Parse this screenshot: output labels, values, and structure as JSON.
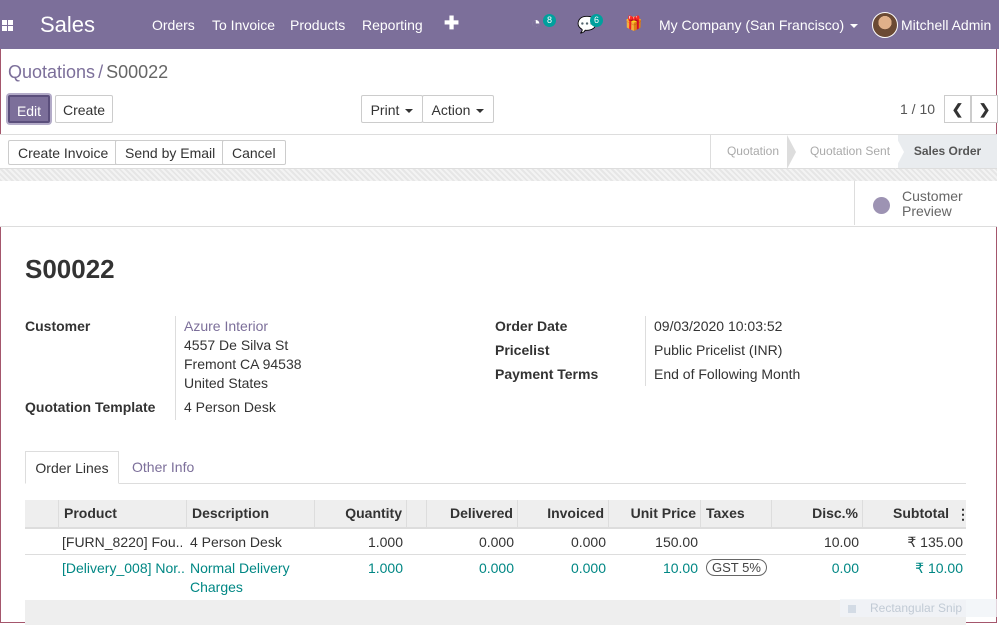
{
  "nav": {
    "app_name": "Sales",
    "menu": [
      "Orders",
      "To Invoice",
      "Products",
      "Reporting"
    ],
    "plus": "✚",
    "activity_count": "8",
    "messages_count": "6",
    "company": "My Company (San Francisco)",
    "user": "Mitchell Admin",
    "accent": "#7c6f9a"
  },
  "breadcrumb": {
    "parent": "Quotations",
    "separator": "/",
    "current": "S00022"
  },
  "toolbar": {
    "edit": "Edit",
    "create": "Create",
    "print": "Print",
    "action": "Action"
  },
  "pager": {
    "value": "1 / 10",
    "prev": "❮",
    "next": "❯"
  },
  "statusbar": {
    "buttons": [
      "Create Invoice",
      "Send by Email",
      "Cancel"
    ],
    "stages": [
      "Quotation",
      "Quotation Sent",
      "Sales Order"
    ],
    "active_stage": "Sales Order"
  },
  "smart_button": {
    "label": "Customer Preview"
  },
  "form": {
    "name": "S00022",
    "customer_label": "Customer",
    "customer_name": "Azure Interior",
    "customer_address": [
      "4557 De Silva St",
      "Fremont CA 94538",
      "United States"
    ],
    "template_label": "Quotation Template",
    "template_value": "4 Person Desk",
    "order_date_label": "Order Date",
    "order_date_value": "09/03/2020 10:03:52",
    "pricelist_label": "Pricelist",
    "pricelist_value": "Public Pricelist (INR)",
    "payment_terms_label": "Payment Terms",
    "payment_terms_value": "End of Following Month"
  },
  "tabs": [
    "Order Lines",
    "Other Info"
  ],
  "table": {
    "columns": [
      "Product",
      "Description",
      "Quantity",
      "Delivered",
      "Invoiced",
      "Unit Price",
      "Taxes",
      "Disc.%",
      "Subtotal"
    ],
    "rows": [
      {
        "product": "[FURN_8220] Fou...",
        "description": "4 Person Desk",
        "description2": "",
        "quantity": "1.000",
        "delivered": "0.000",
        "invoiced": "0.000",
        "unit_price": "150.00",
        "taxes": "",
        "discount": "10.00",
        "subtotal": "₹ 135.00"
      },
      {
        "product": "[Delivery_008] Nor...",
        "description": "Normal Delivery",
        "description2": "Charges",
        "quantity": "1.000",
        "delivered": "0.000",
        "invoiced": "0.000",
        "unit_price": "10.00",
        "taxes": "GST 5%",
        "discount": "0.00",
        "subtotal": "₹ 10.00"
      }
    ]
  },
  "overlay": {
    "snip_label": "Rectangular Snip"
  }
}
